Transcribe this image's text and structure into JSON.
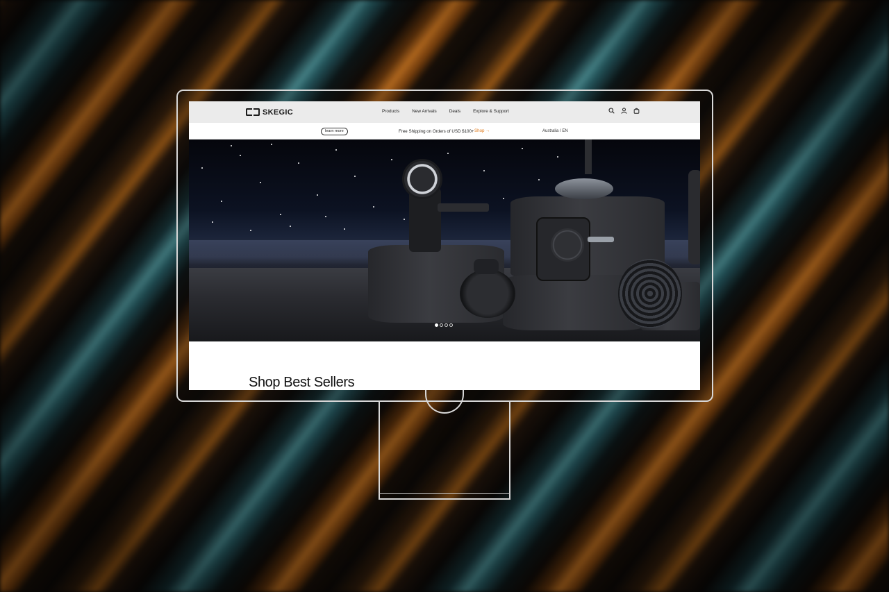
{
  "site": {
    "logo_text": "SKEGIC"
  },
  "nav": {
    "items": [
      "Products",
      "New Arrivals",
      "Deals",
      "Explore & Support"
    ],
    "icons": [
      "search-icon",
      "account-icon",
      "cart-icon"
    ]
  },
  "promo": {
    "learn_more": "learn more",
    "text": "Free Shipping on Orders of USD $100+",
    "shop": "Shop →",
    "region": "Australia / EN"
  },
  "hero": {
    "slides_total": 4,
    "active_slide": 1
  },
  "section": {
    "title": "Shop Best Sellers"
  },
  "colors": {
    "accent": "#e07a1b",
    "navbar_bg": "#ebebeb",
    "frame": "#d8d8d8"
  }
}
